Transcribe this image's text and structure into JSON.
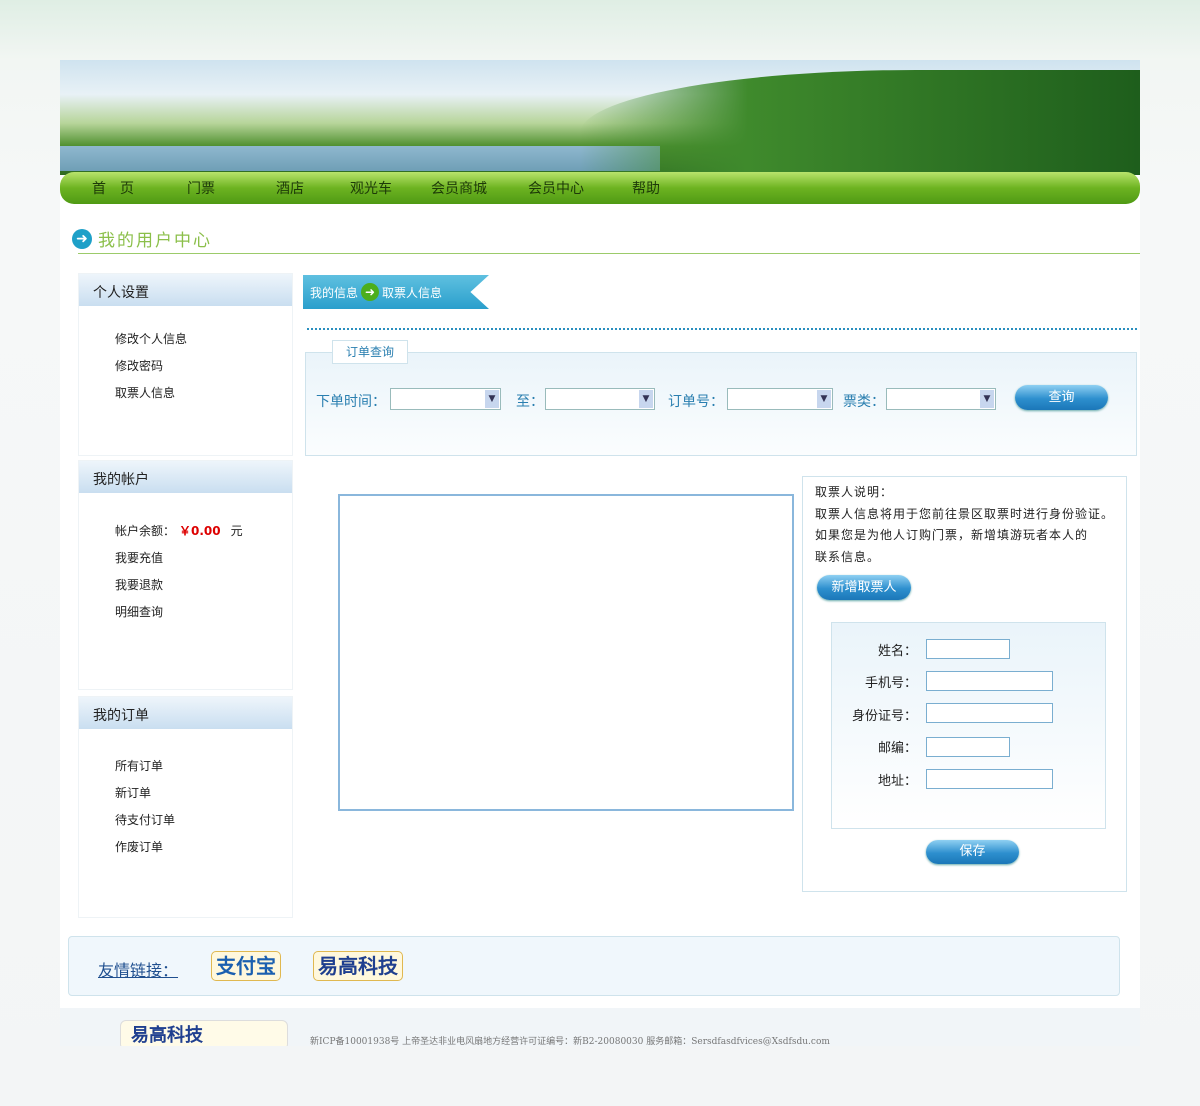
{
  "nav": [
    "首　页",
    "门票",
    "酒店",
    "观光车",
    "会员商城",
    "会员中心",
    "帮助"
  ],
  "page_title": "我的用户中心",
  "sidebar": [
    {
      "title": "个人设置",
      "items": [
        "修改个人信息",
        "修改密码",
        "取票人信息"
      ]
    },
    {
      "title": "我的帐户",
      "balance_label": "帐户余额：",
      "balance": "￥0.00",
      "balance_unit": "元",
      "items": [
        "我要充值",
        "我要退款",
        "明细查询"
      ]
    },
    {
      "title": "我的订单",
      "items": [
        "所有订单",
        "新订单",
        "待支付订单",
        "作废订单"
      ]
    }
  ],
  "breadcrumb": {
    "parent": "我的信息",
    "current": "取票人信息"
  },
  "query": {
    "legend": "订单查询",
    "order_time": "下单时间：",
    "to": "至：",
    "order_no": "订单号：",
    "ticket_type": "票类：",
    "button": "查询"
  },
  "info": {
    "title": "取票人说明：",
    "lines": [
      "取票人信息将用于您前往景区取票时进行身份验证。",
      "如果您是为他人订购门票，新增填游玩者本人的",
      "联系信息。"
    ],
    "add_button": "新增取票人"
  },
  "form": {
    "name": "姓名：",
    "phone": "手机号：",
    "id": "身份证号：",
    "zip": "邮编：",
    "address": "地址：",
    "save": "保存"
  },
  "links": {
    "label": "友情链接：",
    "items": [
      "支付宝",
      "易高科技"
    ]
  },
  "footer": {
    "logo": "易高科技",
    "text": "新ICP备10001938号 上帝圣达非业电风扇地方经营许可证编号：新B2-20080030 服务邮箱：Sersdfasdfvices@Xsdfsdu.com"
  }
}
